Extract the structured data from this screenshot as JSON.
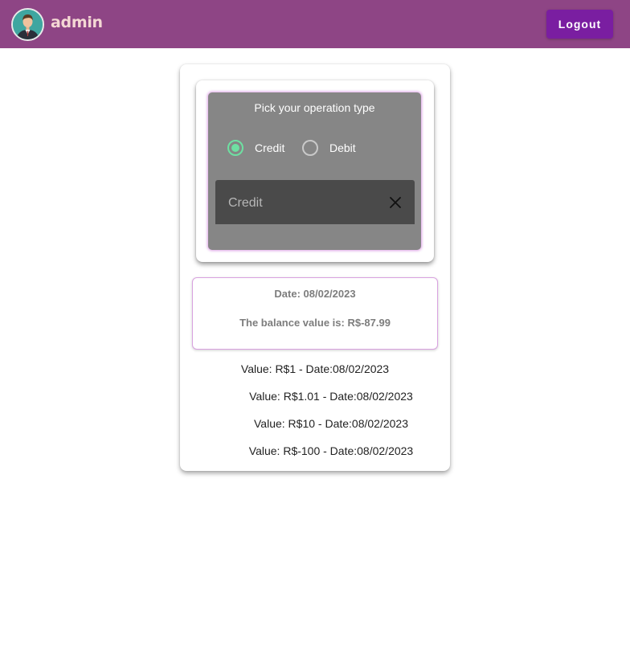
{
  "header": {
    "username": "admin",
    "logout_label": "Logout",
    "avatar_icon": "user-avatar-icon",
    "colors": {
      "bar": "#8e4585",
      "button": "#7a1ea1"
    }
  },
  "operation": {
    "title": "Pick your operation type",
    "options": [
      {
        "label": "Credit",
        "selected": true
      },
      {
        "label": "Debit",
        "selected": false
      }
    ],
    "select_value": "Credit",
    "clear_icon": "close-icon"
  },
  "balance": {
    "date": "Date: 08/02/2023",
    "value": "The balance value is: R$-87.99"
  },
  "transactions": [
    "Value: R$1 - Date:08/02/2023",
    "Value: R$1.01 - Date:08/02/2023",
    "Value: R$10 - Date:08/02/2023",
    "Value: R$-100 - Date:08/02/2023"
  ]
}
